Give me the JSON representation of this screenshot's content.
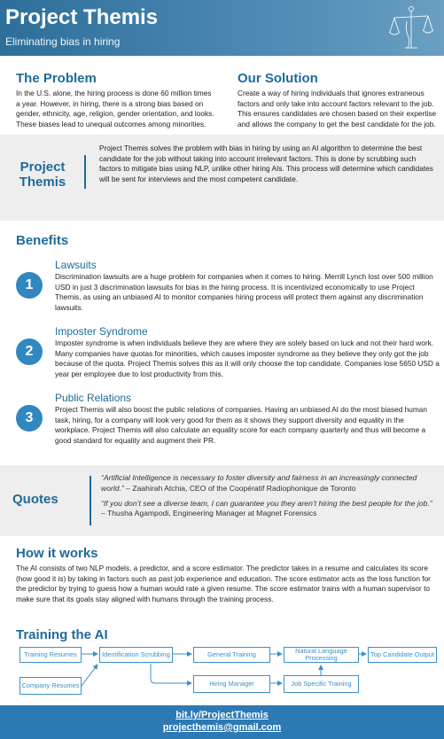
{
  "header": {
    "title": "Project Themis",
    "subtitle": "Eliminating bias in hiring",
    "logo_icon": "scales-of-justice-icon"
  },
  "problem": {
    "title": "The Problem",
    "text": "In the U.S. alone, the hiring process is done 60 million times a year. However, in hiring, there is a strong bias based on gender, ethnicity, age, religion, gender orientation, and looks. These biases lead to unequal outcomes among minorities."
  },
  "solution": {
    "title": "Our Solution",
    "text": "Create a way of hiring individuals that ignores extraneous factors and only take into account factors relevant to the job. This ensures candidates are chosen based on their expertise and allows the company to get the best candidate for the job."
  },
  "project_themis": {
    "label": "Project Themis",
    "text": "Project Themis solves the problem with bias in hiring by using an AI algorithm to determine the best candidate for the job without taking into account irrelevant factors. This is done by scrubbing such factors to mitigate bias using NLP, unlike other hiring AIs. This process will determine which candidates will be sent for interviews and the most competent candidate."
  },
  "benefits": {
    "title": "Benefits",
    "items": [
      {
        "number": "1",
        "name": "Lawsuits",
        "text": "Discrimination lawsuits are a huge problem for companies when it comes to hiring. Merrill Lynch lost over 500 million USD in just 3 discrimination lawsuits for bias in the hiring process. It is incentivized economically to use Project Themis, as using an unbiased AI to monitor companies hiring process will protect them against any discrimination lawsuits."
      },
      {
        "number": "2",
        "name": "Imposter Syndrome",
        "text": "Imposter syndrome is when individuals believe they are where they are solely based on luck and not their hard work. Many companies have quotas for minorities, which causes imposter syndrome as they believe they only got the job because of the quota. Project Themis solves this as it will only choose the top candidate. Companies lose 5650 USD a year per employee due to lost productivity from this."
      },
      {
        "number": "3",
        "name": "Public Relations",
        "text": "Project Themis will also boost the public relations of companies. Having an unbiased AI do the most biased human task, hiring, for a company will look very good for them as it shows they support diversity and equality in the workplace. Project Themis will also calculate an equality score for each company quarterly and thus will become a good standard for equality and augment their PR."
      }
    ]
  },
  "quotes": {
    "label": "Quotes",
    "items": [
      {
        "quote": "“Artificial Intelligence is necessary to foster diversity and fairness in an increasingly connected world.”",
        "attribution": " – Zaahirah Atchia, CEO of the Coopératif Radiophonique de Toronto"
      },
      {
        "quote": "“If you don’t see a diverse team, I can guarantee you they aren’t hiring the best people for the job.”",
        "attribution": " – Thusha Agampodi, Engineering Manager at Magnet Forensics"
      }
    ]
  },
  "how_it_works": {
    "title": "How it works",
    "text": "The AI consists of two NLP models, a predictor, and a score estimator. The predictor takes in a resume and calculates its score (how good it is) by taking in factors such as past job experience and education. The score estimator acts as the loss function for the predictor by trying to guess how a human would rate a given resume. The score estimator trains with a human supervisor to make sure that its goals stay aligned with humans through the training process."
  },
  "training": {
    "title": "Training the AI",
    "nodes": {
      "training_resumes": "Training Resumes",
      "identification_scrubbing": "Identification Scrubbing",
      "general_training": "General Training",
      "nlp": "Natural Language Processing",
      "top_candidate": "Top Candidate Output",
      "company_resumes": "Company Resumes",
      "hiring_manager": "Hiring Manager",
      "job_specific": "Job Specific Training"
    }
  },
  "footer": {
    "link": "bit.ly/ProjectThemis",
    "email": "projecthemis@gmail.com"
  },
  "colors": {
    "accent": "#1f6a99",
    "header_bg": "#3b7fad",
    "footer_bg": "#2d79b4",
    "band_bg": "#eeeeee"
  }
}
